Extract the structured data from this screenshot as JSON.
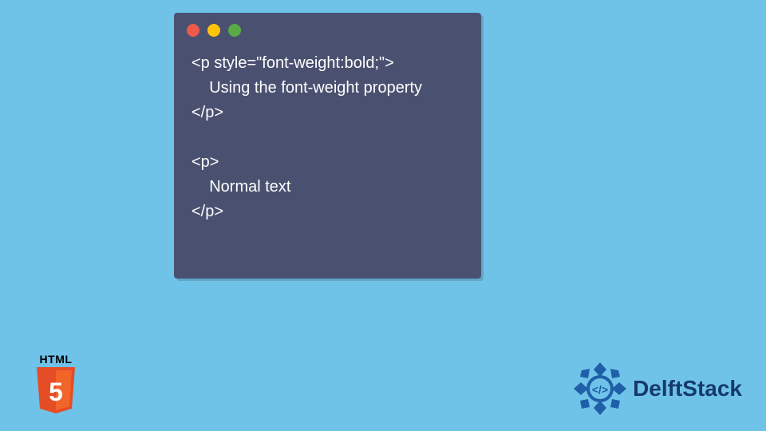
{
  "codeWindow": {
    "trafficLights": [
      "red",
      "yellow",
      "green"
    ],
    "lines": [
      "<p style=\"font-weight:bold;\">",
      "    Using the font-weight property",
      "</p>",
      "",
      "<p>",
      "    Normal text",
      "</p>"
    ]
  },
  "badges": {
    "html5": {
      "label": "HTML",
      "shieldNumber": "5",
      "colors": {
        "outer": "#e44d26",
        "inner": "#f16529",
        "text": "#ffffff"
      }
    },
    "delftstack": {
      "text": "DelftStack",
      "logoColor": "#1f5fa8"
    }
  }
}
